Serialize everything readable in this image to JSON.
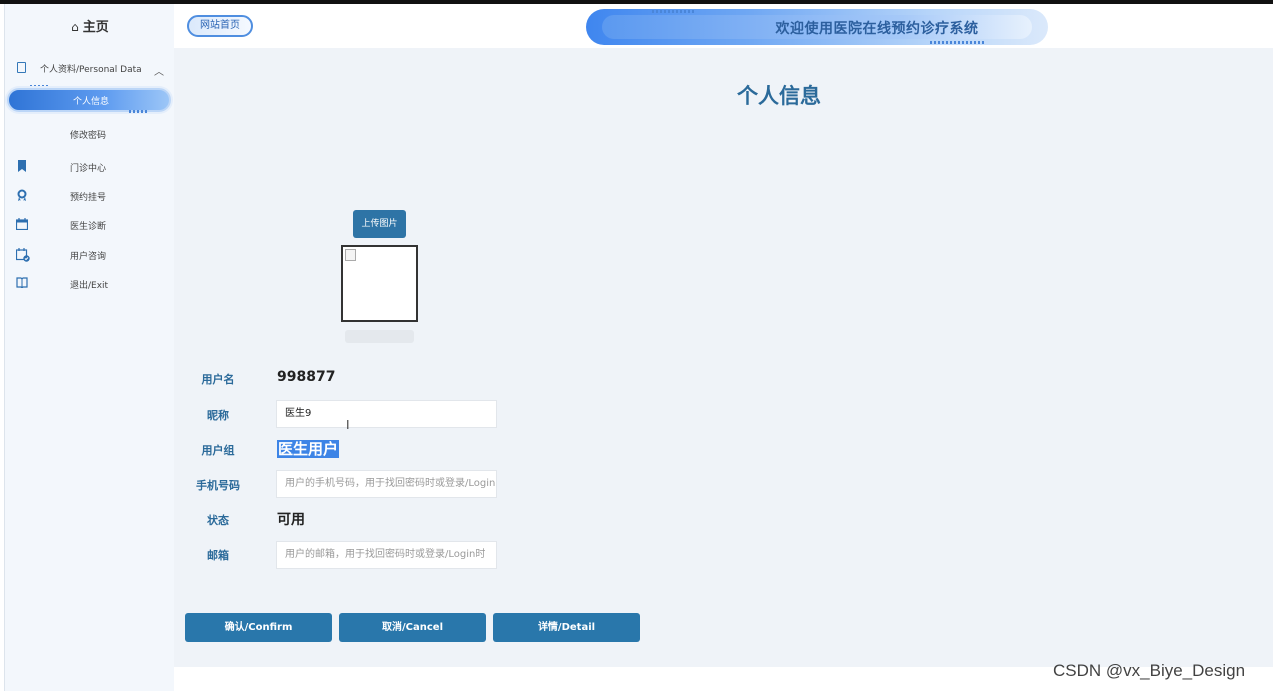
{
  "sidebar": {
    "home_label": "主页",
    "group_label": "个人资料/Personal Data",
    "active_item": "个人信息",
    "sub_item": "修改密码",
    "items": [
      {
        "label": "门诊中心",
        "icon": "bookmark-icon"
      },
      {
        "label": "预约挂号",
        "icon": "award-icon"
      },
      {
        "label": "医生诊断",
        "icon": "calendar-icon"
      },
      {
        "label": "用户咨询",
        "icon": "calendar-check-icon"
      },
      {
        "label": "退出/Exit",
        "icon": "book-icon"
      }
    ]
  },
  "header": {
    "home_link": "网站首页",
    "banner_title": "欢迎使用医院在线预约诊疗系统"
  },
  "main": {
    "title": "个人信息",
    "upload_button": "上传图片",
    "fields": {
      "username_label": "用户名",
      "username_value": "998877",
      "nickname_label": "昵称",
      "nickname_value": "医生9",
      "group_label": "用户组",
      "group_value": "医生用户",
      "phone_label": "手机号码",
      "phone_placeholder": "用户的手机号码，用于找回密码时或登录/Login时",
      "status_label": "状态",
      "status_value": "可用",
      "email_label": "邮箱",
      "email_placeholder": "用户的邮箱，用于找回密码时或登录/Login时"
    },
    "buttons": {
      "confirm": "确认/Confirm",
      "cancel": "取消/Cancel",
      "detail": "详情/Detail"
    }
  },
  "watermark": "CSDN @vx_Biye_Design",
  "colors": {
    "primary": "#2977ab",
    "title": "#2b6a9a",
    "sidebar_bg": "#f3f7fc",
    "main_bg": "#eff3f8",
    "highlight": "#3d84e6"
  }
}
